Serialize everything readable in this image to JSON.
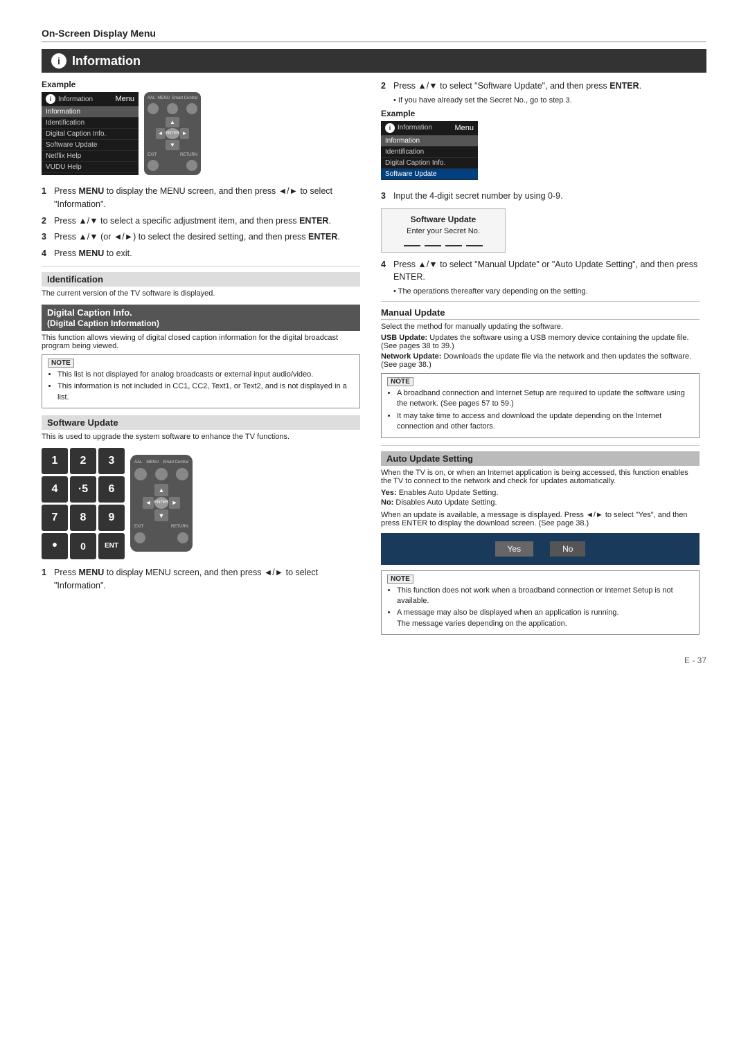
{
  "page": {
    "header": "On-Screen Display Menu",
    "section_title": "Information",
    "page_number": "E - 37"
  },
  "left_column": {
    "example_label": "Example",
    "menu_items": [
      {
        "label": "Information",
        "type": "header_item"
      },
      {
        "label": "Identification",
        "type": "item"
      },
      {
        "label": "Digital Caption Info.",
        "type": "item"
      },
      {
        "label": "Software Update",
        "type": "item"
      },
      {
        "label": "Netflix Help",
        "type": "item"
      },
      {
        "label": "VUDU Help",
        "type": "item"
      }
    ],
    "menu_header_info": "Information",
    "menu_header_label": "Menu",
    "steps": [
      {
        "num": "1",
        "text": "Press MENU to display the MENU screen, and then press ◄/► to select \"Information\"."
      },
      {
        "num": "2",
        "text": "Press ▲/▼ to select a specific adjustment item, and then press ENTER."
      },
      {
        "num": "3",
        "text": "Press ▲/▼ (or ◄/►) to select the desired setting, and then press ENTER."
      },
      {
        "num": "4",
        "text": "Press MENU to exit."
      }
    ],
    "identification": {
      "title": "Identification",
      "text": "The current version of the TV software is displayed."
    },
    "digital_caption": {
      "title": "Digital Caption Info. (Digital Caption Information)",
      "text": "This function allows viewing of digital closed caption information for the digital broadcast program being viewed.",
      "note_items": [
        "This list is not displayed for analog broadcasts or external input audio/video.",
        "This information is not included in CC1, CC2, Text1, or Text2, and is not displayed in a list."
      ]
    },
    "software_update": {
      "title": "Software Update",
      "text": "This is used to upgrade the system software to enhance the TV functions.",
      "step1": "Press MENU to display MENU screen, and then press ◄/► to select \"Information\"."
    }
  },
  "right_column": {
    "step2_intro": "Press ▲/▼ to select \"Software Update\", and then press ENTER.",
    "step2_note": "If you have already set the Secret No., go to step 3.",
    "example_label": "Example",
    "menu_items_right": [
      {
        "label": "Information",
        "type": "header_item"
      },
      {
        "label": "Identification",
        "type": "item"
      },
      {
        "label": "Digital Caption Info.",
        "type": "item"
      },
      {
        "label": "Software Update",
        "type": "highlighted_item"
      }
    ],
    "step3_text": "Input the 4-digit secret number by using 0-9.",
    "secret_box": {
      "title": "Software Update",
      "label": "Enter your Secret No.",
      "dashes": [
        "—",
        "—",
        "—",
        "—"
      ]
    },
    "step4_text": "Press ▲/▼ to select \"Manual Update\" or \"Auto Update Setting\", and then press ENTER.",
    "step4_note": "The operations thereafter vary depending on the setting.",
    "manual_update": {
      "title": "Manual Update",
      "intro": "Select the method for manually updating the software.",
      "usb_label": "USB Update:",
      "usb_text": "Updates the software using a USB memory device containing the update file. (See pages 38 to 39.)",
      "network_label": "Network Update:",
      "network_text": "Downloads the update file via the network and then updates the software. (See page 38.)",
      "note_items": [
        "A broadband connection and Internet Setup are required to update the software using the network. (See pages 57 to 59.)",
        "It may take time to access and download the update depending on the Internet connection and other factors."
      ]
    },
    "auto_update": {
      "title": "Auto Update Setting",
      "text": "When the TV is on, or when an Internet application is being accessed, this function enables the TV to connect to the network and check for updates automatically.",
      "yes_label": "Yes:",
      "yes_text": "Enables Auto Update Setting.",
      "no_label": "No:",
      "no_text": "Disables Auto Update Setting.",
      "after_text": "When an update is available, a message is displayed. Press ◄/► to select \"Yes\", and then press ENTER to display the download screen. (See page 38.)",
      "note_items": [
        "This function does not work when a broadband connection or Internet Setup is not available.",
        "A message may also be displayed when an application is running. The message varies depending on the application."
      ],
      "button_yes": "Yes",
      "button_no": "No"
    }
  },
  "remote_labels": {
    "aal": "AAL",
    "menu": "MENU",
    "smart_central": "Smart Central",
    "exit": "EXIT",
    "return": "RETURN",
    "enter": "ENTER",
    "up": "▲",
    "down": "▼",
    "left": "◄",
    "right": "►"
  },
  "keypad_keys": [
    "1",
    "2",
    "3",
    "4",
    "·5",
    "6",
    "7",
    "8",
    "9",
    "•",
    "0",
    "ENT"
  ]
}
